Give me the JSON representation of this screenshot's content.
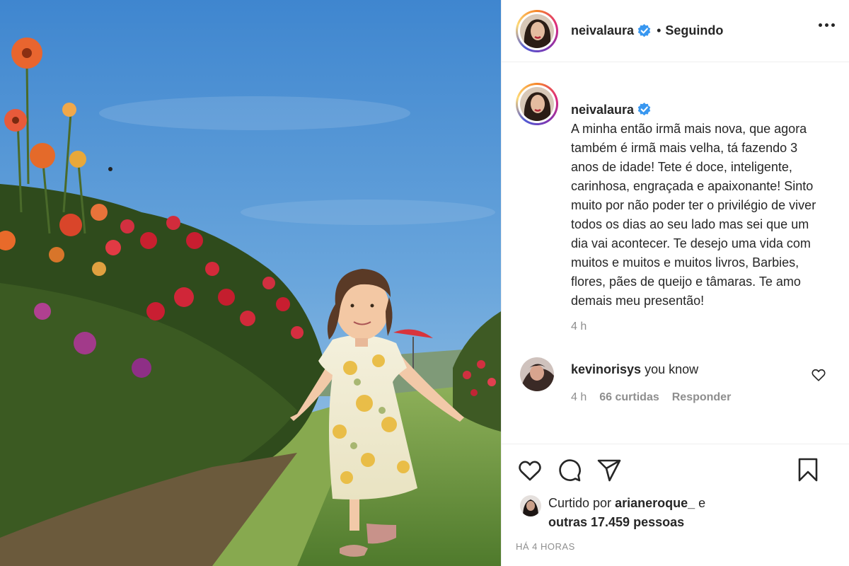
{
  "post": {
    "photo_alt": "Menina correndo entre flores"
  },
  "header": {
    "username": "neivalaura",
    "dot": "•",
    "follow_status": "Seguindo"
  },
  "caption": {
    "username": "neivalaura",
    "text": "A minha então irmã mais nova, que agora também é irmã mais velha, tá fazendo 3 anos de idade! Tete é doce, inteligente, carinhosa, engraçada e apaixonante! Sinto muito por não poder ter o privilégio de viver todos os dias ao seu lado mas sei que um dia vai acontecer. Te desejo uma vida com muitos e muitos e muitos livros, Barbies, flores, pães de queijo e tâmaras. Te amo demais meu presentão!",
    "time": "4 h"
  },
  "comment": {
    "username": "kevinorisys",
    "text": "you know",
    "time": "4 h",
    "likes": "66 curtidas",
    "reply": "Responder"
  },
  "likes": {
    "prefix": "Curtido por",
    "user": "arianeroque_",
    "conj": "e",
    "others": "outras 17.459 pessoas"
  },
  "post_age": "HÁ 4 HORAS",
  "icons": {
    "like": "heart-icon",
    "comment": "comment-icon",
    "share": "paper-plane-icon",
    "save": "bookmark-icon",
    "more": "more-icon",
    "verified": "verified-badge-icon"
  },
  "colors": {
    "verified": "#3897f0",
    "muted": "#8e8e8e",
    "text": "#262626"
  }
}
